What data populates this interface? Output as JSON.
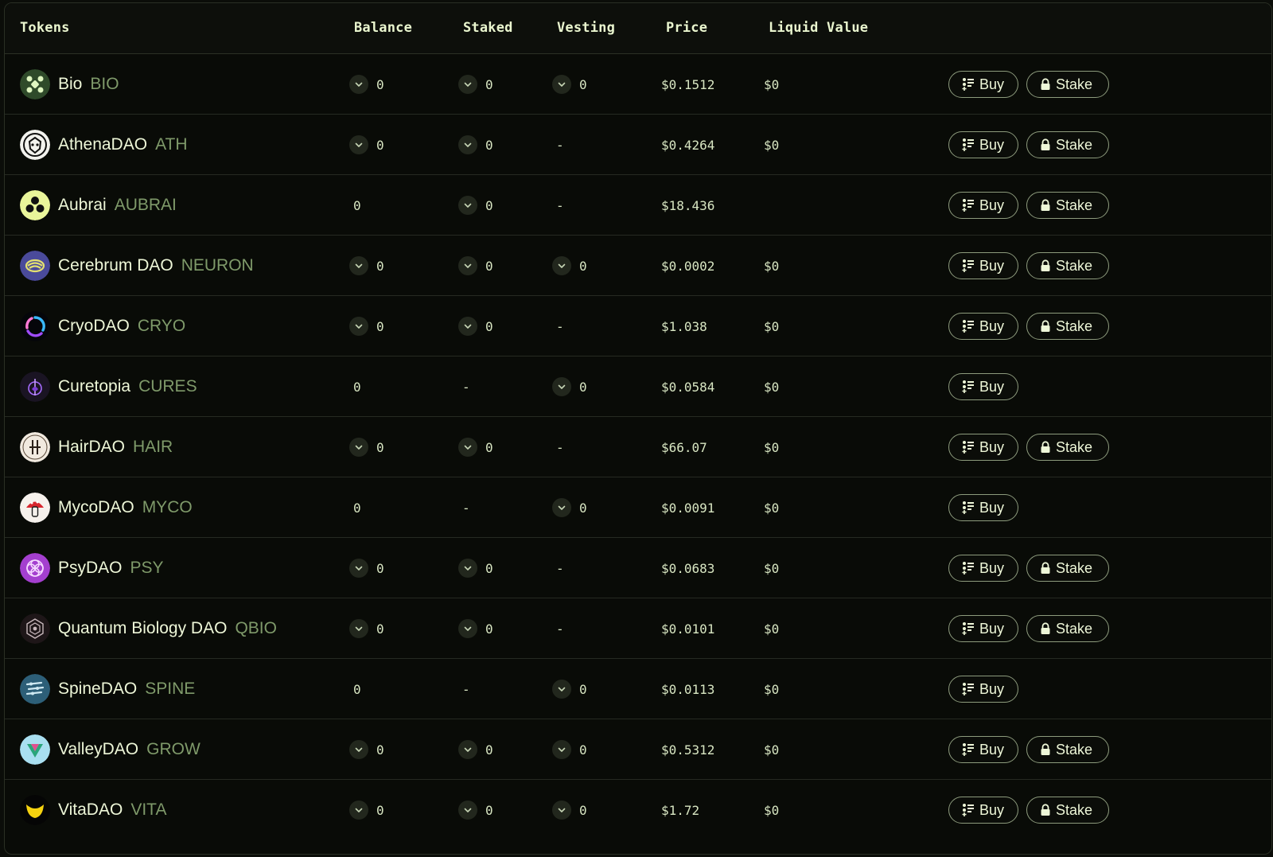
{
  "columns": {
    "tokens": "Tokens",
    "balance": "Balance",
    "staked": "Staked",
    "vesting": "Vesting",
    "price": "Price",
    "liquid_value": "Liquid Value"
  },
  "labels": {
    "buy": "Buy",
    "stake": "Stake"
  },
  "colors": {
    "accent": "#eaf6cf",
    "muted": "#7f9a6a",
    "background": "#090b07",
    "border": "#2b3025"
  },
  "tokens": [
    {
      "name": "Bio",
      "symbol": "BIO",
      "icon": "bio-logo-icon",
      "balance": "0",
      "balance_toggle": true,
      "staked": "0",
      "staked_toggle": true,
      "vesting": "0",
      "vesting_toggle": true,
      "price": "$0.1512",
      "liquid_value": "$0",
      "stake": true
    },
    {
      "name": "AthenaDAO",
      "symbol": "ATH",
      "icon": "athena-logo-icon",
      "balance": "0",
      "balance_toggle": true,
      "staked": "0",
      "staked_toggle": true,
      "vesting": "-",
      "vesting_toggle": false,
      "price": "$0.4264",
      "liquid_value": "$0",
      "stake": true
    },
    {
      "name": "Aubrai",
      "symbol": "AUBRAI",
      "icon": "aubrai-logo-icon",
      "balance": "0",
      "balance_toggle": false,
      "staked": "0",
      "staked_toggle": true,
      "vesting": "-",
      "vesting_toggle": false,
      "price": "$18.436",
      "liquid_value": "",
      "stake": true
    },
    {
      "name": "Cerebrum DAO",
      "symbol": "NEURON",
      "icon": "cerebrum-logo-icon",
      "balance": "0",
      "balance_toggle": true,
      "staked": "0",
      "staked_toggle": true,
      "vesting": "0",
      "vesting_toggle": true,
      "price": "$0.0002",
      "liquid_value": "$0",
      "stake": true
    },
    {
      "name": "CryoDAO",
      "symbol": "CRYO",
      "icon": "cryo-logo-icon",
      "balance": "0",
      "balance_toggle": true,
      "staked": "0",
      "staked_toggle": true,
      "vesting": "-",
      "vesting_toggle": false,
      "price": "$1.038",
      "liquid_value": "$0",
      "stake": true
    },
    {
      "name": "Curetopia",
      "symbol": "CURES",
      "icon": "curetopia-logo-icon",
      "balance": "0",
      "balance_toggle": false,
      "staked": "-",
      "staked_toggle": false,
      "vesting": "0",
      "vesting_toggle": true,
      "price": "$0.0584",
      "liquid_value": "$0",
      "stake": false
    },
    {
      "name": "HairDAO",
      "symbol": "HAIR",
      "icon": "hair-logo-icon",
      "balance": "0",
      "balance_toggle": true,
      "staked": "0",
      "staked_toggle": true,
      "vesting": "-",
      "vesting_toggle": false,
      "price": "$66.07",
      "liquid_value": "$0",
      "stake": true
    },
    {
      "name": "MycoDAO",
      "symbol": "MYCO",
      "icon": "myco-logo-icon",
      "balance": "0",
      "balance_toggle": false,
      "staked": "-",
      "staked_toggle": false,
      "vesting": "0",
      "vesting_toggle": true,
      "price": "$0.0091",
      "liquid_value": "$0",
      "stake": false
    },
    {
      "name": "PsyDAO",
      "symbol": "PSY",
      "icon": "psy-logo-icon",
      "balance": "0",
      "balance_toggle": true,
      "staked": "0",
      "staked_toggle": true,
      "vesting": "-",
      "vesting_toggle": false,
      "price": "$0.0683",
      "liquid_value": "$0",
      "stake": true
    },
    {
      "name": "Quantum Biology DAO",
      "symbol": "QBIO",
      "icon": "qbio-logo-icon",
      "balance": "0",
      "balance_toggle": true,
      "staked": "0",
      "staked_toggle": true,
      "vesting": "-",
      "vesting_toggle": false,
      "price": "$0.0101",
      "liquid_value": "$0",
      "stake": true
    },
    {
      "name": "SpineDAO",
      "symbol": "SPINE",
      "icon": "spine-logo-icon",
      "balance": "0",
      "balance_toggle": false,
      "staked": "-",
      "staked_toggle": false,
      "vesting": "0",
      "vesting_toggle": true,
      "price": "$0.0113",
      "liquid_value": "$0",
      "stake": false
    },
    {
      "name": "ValleyDAO",
      "symbol": "GROW",
      "icon": "valley-logo-icon",
      "balance": "0",
      "balance_toggle": true,
      "staked": "0",
      "staked_toggle": true,
      "vesting": "0",
      "vesting_toggle": true,
      "price": "$0.5312",
      "liquid_value": "$0",
      "stake": true
    },
    {
      "name": "VitaDAO",
      "symbol": "VITA",
      "icon": "vita-logo-icon",
      "balance": "0",
      "balance_toggle": true,
      "staked": "0",
      "staked_toggle": true,
      "vesting": "0",
      "vesting_toggle": true,
      "price": "$1.72",
      "liquid_value": "$0",
      "stake": true
    }
  ]
}
